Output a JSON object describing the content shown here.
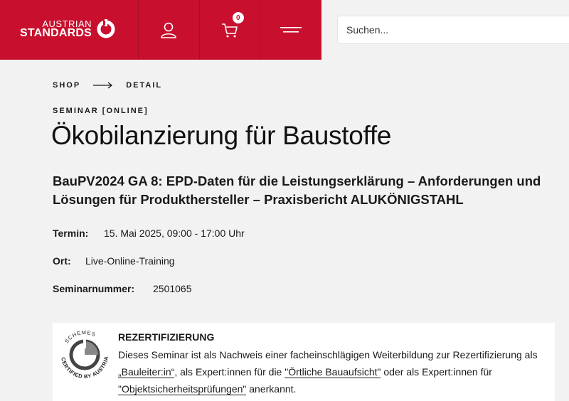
{
  "header": {
    "logo": {
      "line1": "AUSTRIAN",
      "line2": "STANDARDS"
    },
    "account_icon": "user-icon",
    "cart": {
      "icon": "cart-icon",
      "count": "0"
    },
    "menu_icon": "hamburger-menu-icon",
    "search_placeholder": "Suchen...",
    "brand_color": "#c8102e"
  },
  "breadcrumb": {
    "items": [
      "SHOP",
      "DETAIL"
    ]
  },
  "course": {
    "kicker": "SEMINAR [ONLINE]",
    "title": "Ökobilanzierung für Baustoffe",
    "subtitle": "BauPV2024 GA 8: EPD-Daten für die Leistungserklärung – Anforderungen und Lösungen für Produkthersteller – Praxisbericht ALUKÖNIGSTAHL"
  },
  "meta": {
    "termin_label": "Termin:",
    "termin_value": "15. Mai 2025, 09:00 - 17:00 Uhr",
    "ort_label": "Ort:",
    "ort_value": "Live-Online-Training",
    "nr_label": "Seminarnummer:",
    "nr_value": "2501065"
  },
  "recert": {
    "seal_text_top": "SCHEMES",
    "seal_text_bottom": "CERTIFIED BY AUSTRIAN STANDARDS",
    "heading": "REZERTIFIZIERUNG",
    "text_1": "Dieses Seminar ist als Nachweis einer facheinschlägigen Weiterbildung zur Rezertifizierung als ",
    "link_1": "„Bauleiter:in“",
    "text_2": ", als Expert:innen für die ",
    "link_2": "\"Örtliche Bauaufsicht\"",
    "text_3": " oder als Expert:innen für ",
    "link_3": "\"Objektsicherheitsprüfungen\"",
    "text_4": " anerkannt."
  }
}
